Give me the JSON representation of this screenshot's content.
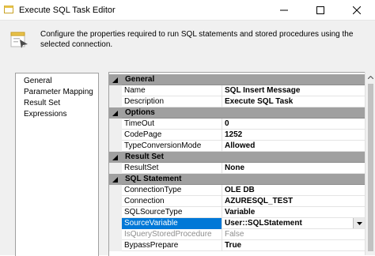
{
  "window": {
    "title": "Execute SQL Task Editor",
    "icon": "sql-task-icon",
    "controls": [
      "minimize-icon",
      "maximize-icon",
      "close-icon"
    ]
  },
  "header": {
    "icon": "configure-icon",
    "description": "Configure the properties required to run SQL statements and stored procedures using the selected connection."
  },
  "nav": {
    "items": [
      {
        "label": "General",
        "selected": true
      },
      {
        "label": "Parameter Mapping"
      },
      {
        "label": "Result Set"
      },
      {
        "label": "Expressions"
      }
    ]
  },
  "grid": {
    "categories": [
      {
        "label": "General",
        "rows": [
          {
            "name": "Name",
            "value": "SQL Insert Message"
          },
          {
            "name": "Description",
            "value": "Execute SQL Task"
          }
        ]
      },
      {
        "label": "Options",
        "rows": [
          {
            "name": "TimeOut",
            "value": "0"
          },
          {
            "name": "CodePage",
            "value": "1252"
          },
          {
            "name": "TypeConversionMode",
            "value": "Allowed"
          }
        ]
      },
      {
        "label": "Result Set",
        "rows": [
          {
            "name": "ResultSet",
            "value": "None"
          }
        ]
      },
      {
        "label": "SQL Statement",
        "rows": [
          {
            "name": "ConnectionType",
            "value": "OLE DB"
          },
          {
            "name": "Connection",
            "value": "AZURESQL_TEST"
          },
          {
            "name": "SQLSourceType",
            "value": "Variable"
          },
          {
            "name": "SourceVariable",
            "value": "User::SQLStatement",
            "selected": true
          },
          {
            "name": "IsQueryStoredProcedure",
            "value": "False",
            "disabled": true
          },
          {
            "name": "BypassPrepare",
            "value": "True"
          }
        ]
      }
    ]
  },
  "colors": {
    "category_bg": "#a0a0a0",
    "selection": "#0078d7",
    "dialog_bg": "#f0f0f0"
  }
}
